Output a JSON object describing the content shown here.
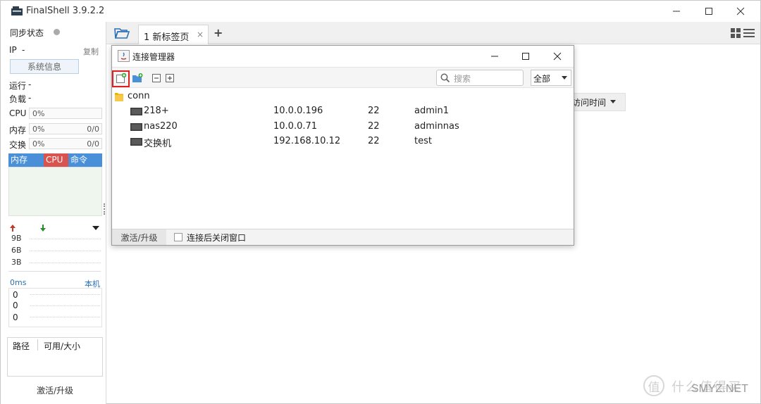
{
  "window": {
    "title": "FinalShell 3.9.2.2"
  },
  "left_panel": {
    "sync_status": "同步状态",
    "ip_label": "IP",
    "ip_value": "-",
    "copy_link": "复制",
    "sysinfo_button": "系统信息",
    "uptime_label": "运行",
    "uptime_value": "-",
    "load_label": "负载",
    "load_value": "-",
    "cpu_label": "CPU",
    "cpu_value": "0%",
    "mem_label": "内存",
    "mem_value": "0%",
    "mem_total": "0/0",
    "swap_label": "交换",
    "swap_value": "0%",
    "swap_total": "0/0",
    "proc_tabs": [
      "内存",
      "CPU",
      "命令"
    ],
    "net_rates": [
      "9B",
      "6B",
      "3B"
    ],
    "latency_label": "0ms",
    "latency_host": "本机",
    "latency_values": [
      "0",
      "0",
      "0"
    ],
    "disk_cols": [
      "路径",
      "可用/大小"
    ],
    "activate": "激活/升级"
  },
  "main": {
    "tab_label": "1 新标签页",
    "tab_close": "×",
    "tab_add": "+",
    "sort_label": "访问时间"
  },
  "dialog": {
    "title": "连接管理器",
    "search_placeholder": "搜索",
    "filter_value": "全部",
    "folder": "conn",
    "connections": [
      {
        "name": "218+",
        "host": "10.0.0.196",
        "port": "22",
        "user": "admin1"
      },
      {
        "name": "nas220",
        "host": "10.0.0.71",
        "port": "22",
        "user": "adminnas"
      },
      {
        "name": "交换机",
        "host": "192.168.10.12",
        "port": "22",
        "user": "test"
      }
    ],
    "status_activate": "激活/升级",
    "close_after_connect": "连接后关闭窗口"
  },
  "watermark": {
    "text": "什么值得买",
    "site": "SMYZ.NET",
    "logo": "值"
  },
  "colors": {
    "accent": "#4a90d9",
    "cpu_tab": "#d9534f",
    "highlight": "#e02020"
  }
}
